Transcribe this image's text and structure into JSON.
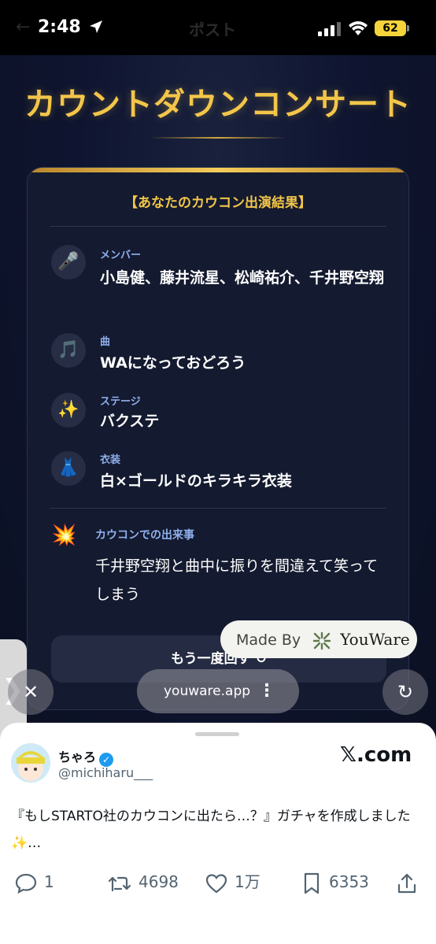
{
  "status_bar": {
    "time": "2:48",
    "page_title": "ポスト",
    "battery": "62"
  },
  "app": {
    "title": "カウントダウンコンサート",
    "card_heading": "【あなたのカウコン出演結果】",
    "rows": [
      {
        "icon": "microphone-icon",
        "emoji": "🎤",
        "label": "メンバー",
        "value": "小島健、藤井流星、松崎祐介、千井野空翔"
      },
      {
        "icon": "music-note-icon",
        "emoji": "🎵",
        "label": "曲",
        "value": "WAになっておどろう"
      },
      {
        "icon": "sparkles-icon",
        "emoji": "✨",
        "label": "ステージ",
        "value": "バクステ"
      },
      {
        "icon": "dress-icon",
        "emoji": "👗",
        "label": "衣装",
        "value": "白×ゴールドのキラキラ衣装"
      }
    ],
    "event": {
      "icon": "explosion-icon",
      "emoji": "💥",
      "label": "カウコンでの出来事",
      "text": "千井野空翔と曲中に振りを間違えて笑ってしまう"
    },
    "retry_button": "もう一度回す",
    "made_by": {
      "prefix": "Made By",
      "brand": "YouWare"
    }
  },
  "browser": {
    "url": "youware.app"
  },
  "tweet": {
    "author": "ちゃろ",
    "handle": "@michiharu___",
    "site": "𝕏.com",
    "text": "『もしSTARTO社のカウコンに出たら…？』ガチャを作成しました✨…",
    "replies": "1",
    "retweets": "4698",
    "likes": "1万",
    "bookmarks": "6353"
  }
}
